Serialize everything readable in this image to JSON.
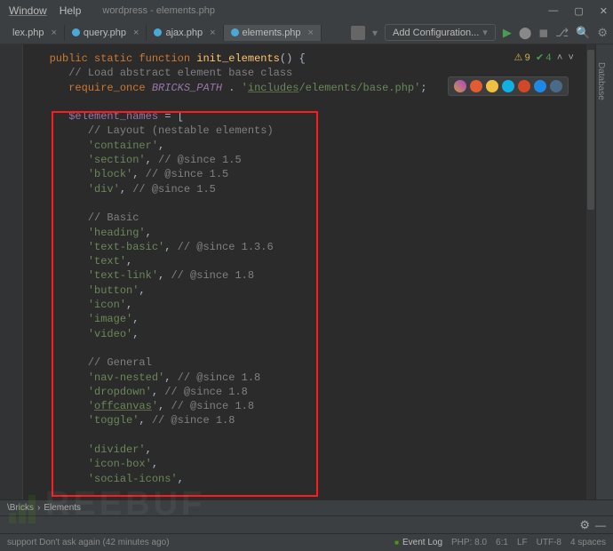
{
  "titlebar": {
    "menu_window": "Window",
    "menu_help": "Help",
    "project": "wordpress - elements.php"
  },
  "tabs": [
    {
      "label": "lex.php",
      "active": false
    },
    {
      "label": "query.php",
      "active": false
    },
    {
      "label": "ajax.php",
      "active": false
    },
    {
      "label": "elements.php",
      "active": true
    }
  ],
  "toolbar": {
    "config_label": "Add Configuration..."
  },
  "inspections": {
    "warn": "9",
    "ok": "4"
  },
  "code": {
    "l1_kw1": "public",
    "l1_kw2": "static",
    "l1_kw3": "function",
    "l1_fn": "init_elements",
    "l2_c": "// Load abstract element base class",
    "l3_kw": "require_once",
    "l3_const": "BRICKS_PATH",
    "l3_dot": " . ",
    "l3_s1": "'",
    "l3_inc": "includes",
    "l3_s2": "/elements/base.php'",
    "l3_semi": ";",
    "l5_var": "$element_names",
    "l5_eq": " = [",
    "l6": "// Layout (nestable elements)",
    "l7": "'container'",
    "l7c": ",",
    "l8": "'section'",
    "l8c": ", // @since 1.5",
    "l9": "'block'",
    "l9c": ", // @since 1.5",
    "l10": "'div'",
    "l10c": ", // @since 1.5",
    "l12": "// Basic",
    "l13": "'heading'",
    "l13c": ",",
    "l14": "'text-basic'",
    "l14c": ", // @since 1.3.6",
    "l15": "'text'",
    "l15c": ",",
    "l16": "'text-link'",
    "l16c": ", // @since 1.8",
    "l17": "'button'",
    "l17c": ",",
    "l18": "'icon'",
    "l18c": ",",
    "l19": "'image'",
    "l19c": ",",
    "l20": "'video'",
    "l20c": ",",
    "l22": "// General",
    "l23": "'nav-nested'",
    "l23c": ", // @since 1.8",
    "l24": "'dropdown'",
    "l24c": ", // @since 1.8",
    "l25a": "'",
    "l25u": "offcanvas",
    "l25b": "'",
    "l25c": ", // @since 1.8",
    "l26": "'toggle'",
    "l26c": ", // @since 1.8",
    "l28": "'divider'",
    "l28c": ",",
    "l29": "'icon-box'",
    "l29c": ",",
    "l30": "'social-icons'",
    "l30c": ","
  },
  "breadcrumb": {
    "a": "\\Bricks",
    "sep": "›",
    "b": "Elements"
  },
  "rside": {
    "label": "Database"
  },
  "status": {
    "left": "support   Don't ask again (42 minutes ago)",
    "event_log": "Event Log",
    "php": "PHP: 8.0",
    "pos": "6:1",
    "le": "LF",
    "enc": "UTF-8",
    "indent": "4 spaces"
  },
  "watermark": "REEBUF"
}
